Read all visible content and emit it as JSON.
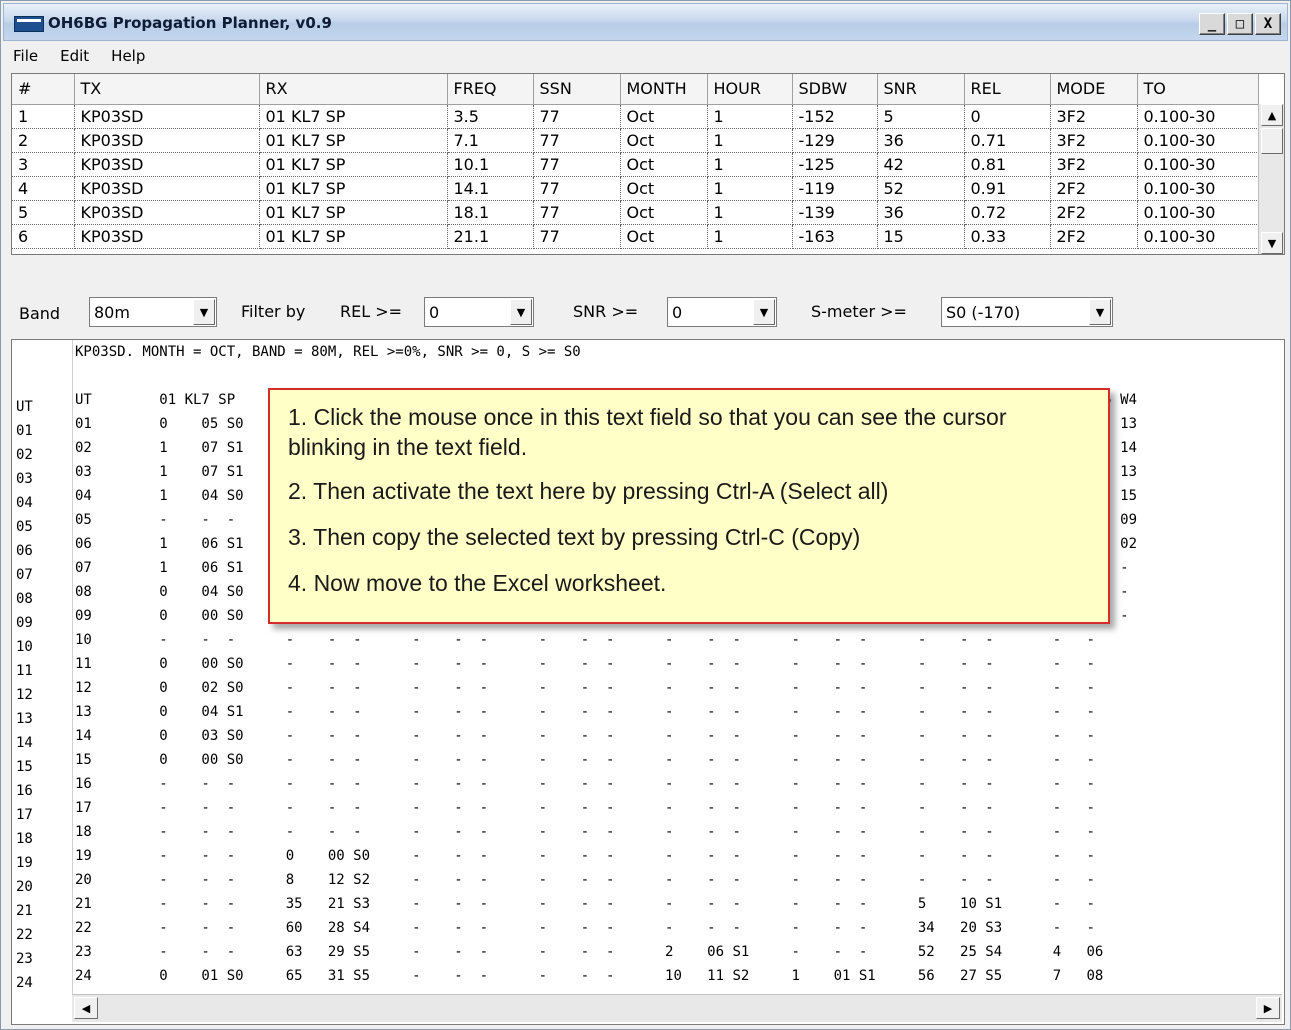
{
  "window": {
    "title": "OH6BG Propagation Planner, v0.9",
    "buttons": [
      "_",
      "□",
      "X"
    ]
  },
  "menu": [
    "File",
    "Edit",
    "Help"
  ],
  "table": {
    "columns": [
      "#",
      "TX",
      "RX",
      "FREQ",
      "SSN",
      "MONTH",
      "HOUR",
      "SDBW",
      "SNR",
      "REL",
      "MODE",
      "TO"
    ],
    "rows": [
      [
        "1",
        "KP03SD",
        "01 KL7 SP",
        "3.5",
        "77",
        "Oct",
        "1",
        "-152",
        "5",
        "0",
        "3F2",
        "0.100-30"
      ],
      [
        "2",
        "KP03SD",
        "01 KL7 SP",
        "7.1",
        "77",
        "Oct",
        "1",
        "-129",
        "36",
        "0.71",
        "3F2",
        "0.100-30"
      ],
      [
        "3",
        "KP03SD",
        "01 KL7 SP",
        "10.1",
        "77",
        "Oct",
        "1",
        "-125",
        "42",
        "0.81",
        "3F2",
        "0.100-30"
      ],
      [
        "4",
        "KP03SD",
        "01 KL7 SP",
        "14.1",
        "77",
        "Oct",
        "1",
        "-119",
        "52",
        "0.91",
        "2F2",
        "0.100-30"
      ],
      [
        "5",
        "KP03SD",
        "01 KL7 SP",
        "18.1",
        "77",
        "Oct",
        "1",
        "-139",
        "36",
        "0.72",
        "2F2",
        "0.100-30"
      ],
      [
        "6",
        "KP03SD",
        "01 KL7 SP",
        "21.1",
        "77",
        "Oct",
        "1",
        "-163",
        "15",
        "0.33",
        "2F2",
        "0.100-30"
      ]
    ]
  },
  "filters": {
    "band_label": "Band",
    "band_value": "80m",
    "filter_by_label": "Filter by",
    "rel_label": "REL >=",
    "rel_value": "0",
    "snr_label": "SNR >=",
    "snr_value": "0",
    "smeter_label": "S-meter >=",
    "smeter_value": "S0 (-170)"
  },
  "output": {
    "line_numbers": [
      "UT",
      "01",
      "02",
      "03",
      "04",
      "05",
      "06",
      "07",
      "08",
      "09",
      "10",
      "11",
      "12",
      "13",
      "14",
      "15",
      "16",
      "17",
      "18",
      "19",
      "20",
      "21",
      "22",
      "23",
      "24"
    ],
    "text": "KP03SD. MONTH = OCT, BAND = 80M, REL >=0%, SNR >= 0, S >= S0\n\nUT        01 KL7 SP                                                                                          1 SP        05 W4\n01        0    05 S0                                                                                        29 S6       11  13\n02        1    07 S1                                                                                        29 S6       12  14\n03        1    07 S1                                                                                        28 S6       7   13\n04        1    04 S0                                                                                        33 S7       10  15\n05        -    -  -                                                                                         32 S7       1   09\n06        1    06 S1                                                                                        24 S6       0   02\n07        1    06 S1                                                                                        13 S4       -   -\n08        0    04 S0                                                                                        06 S3       -   -\n09        0    00 S0                                                                                        -   -       -   -\n10        -    -  -      -    -  -      -    -  -      -    -  -      -    -  -      -    -  -      -    -  -       -   -\n11        0    00 S0     -    -  -      -    -  -      -    -  -      -    -  -      -    -  -      -    -  -       -   -\n12        0    02 S0     -    -  -      -    -  -      -    -  -      -    -  -      -    -  -      -    -  -       -   -\n13        0    04 S1     -    -  -      -    -  -      -    -  -      -    -  -      -    -  -      -    -  -       -   -\n14        0    03 S0     -    -  -      -    -  -      -    -  -      -    -  -      -    -  -      -    -  -       -   -\n15        0    00 S0     -    -  -      -    -  -      -    -  -      -    -  -      -    -  -      -    -  -       -   -\n16        -    -  -      -    -  -      -    -  -      -    -  -      -    -  -      -    -  -      -    -  -       -   -\n17        -    -  -      -    -  -      -    -  -      -    -  -      -    -  -      -    -  -      -    -  -       -   -\n18        -    -  -      -    -  -      -    -  -      -    -  -      -    -  -      -    -  -      -    -  -       -   -\n19        -    -  -      0    00 S0     -    -  -      -    -  -      -    -  -      -    -  -      -    -  -       -   -\n20        -    -  -      8    12 S2     -    -  -      -    -  -      -    -  -      -    -  -      -    -  -       -   -\n21        -    -  -      35   21 S3     -    -  -      -    -  -      -    -  -      -    -  -      5    10 S1      -   -\n22        -    -  -      60   28 S4     -    -  -      -    -  -      -    -  -      -    -  -      34   20 S3      -   -\n23        -    -  -      63   29 S5     -    -  -      -    -  -      2    06 S1     -    -  -      52   25 S4      4   06\n24        0    01 S0     65   31 S5     -    -  -      -    -  -      10   11 S2     1    01 S1     56   27 S5      7   08"
  },
  "callout": {
    "step1": "1. Click the mouse once in this text field so that you can see the cursor blinking in the text field.",
    "step2": "2. Then activate the text here by pressing Ctrl-A (Select all)",
    "step3": "3. Then copy the selected text by pressing Ctrl-C (Copy)",
    "step4": "4. Now move to the Excel worksheet."
  },
  "colors": {
    "callout_border": "#d42b2b",
    "callout_background": "#ffffc8"
  }
}
